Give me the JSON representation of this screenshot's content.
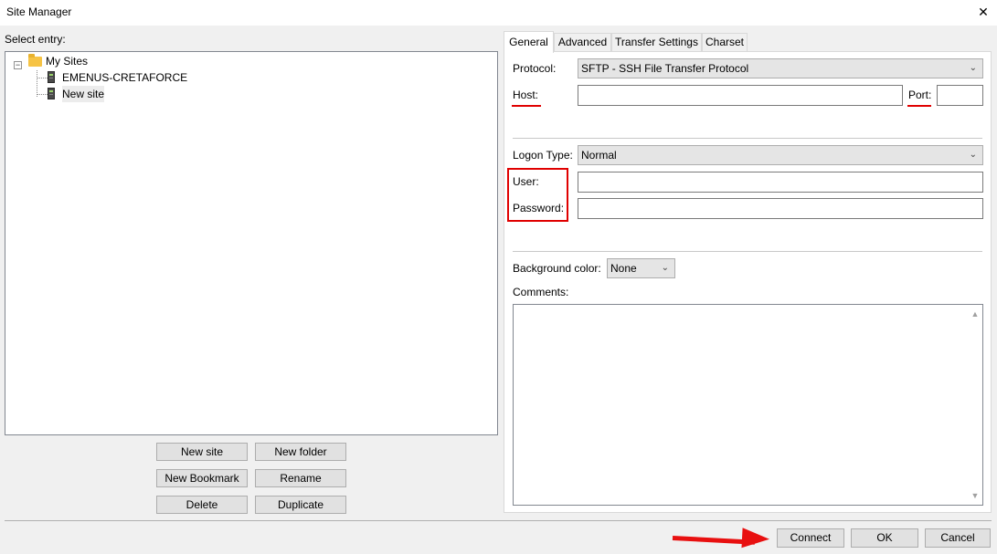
{
  "window": {
    "title": "Site Manager"
  },
  "tree": {
    "label": "Select entry:",
    "root": "My Sites",
    "items": [
      "EMENUS-CRETAFORCE",
      "New site"
    ]
  },
  "left_buttons": {
    "new_site": "New site",
    "new_folder": "New folder",
    "new_bookmark": "New Bookmark",
    "rename": "Rename",
    "delete": "Delete",
    "duplicate": "Duplicate"
  },
  "tabs": [
    "General",
    "Advanced",
    "Transfer Settings",
    "Charset"
  ],
  "general": {
    "protocol_label": "Protocol:",
    "protocol_value": "SFTP - SSH File Transfer Protocol",
    "host_label": "Host:",
    "host_value": "",
    "port_label": "Port:",
    "port_value": "",
    "logon_type_label": "Logon Type:",
    "logon_type_value": "Normal",
    "user_label": "User:",
    "user_value": "",
    "password_label": "Password:",
    "password_value": "",
    "bg_color_label": "Background color:",
    "bg_color_value": "None",
    "comments_label": "Comments:",
    "comments_value": ""
  },
  "bottom_buttons": {
    "connect": "Connect",
    "ok": "OK",
    "cancel": "Cancel"
  },
  "colors": {
    "annotation": "#e00000"
  }
}
